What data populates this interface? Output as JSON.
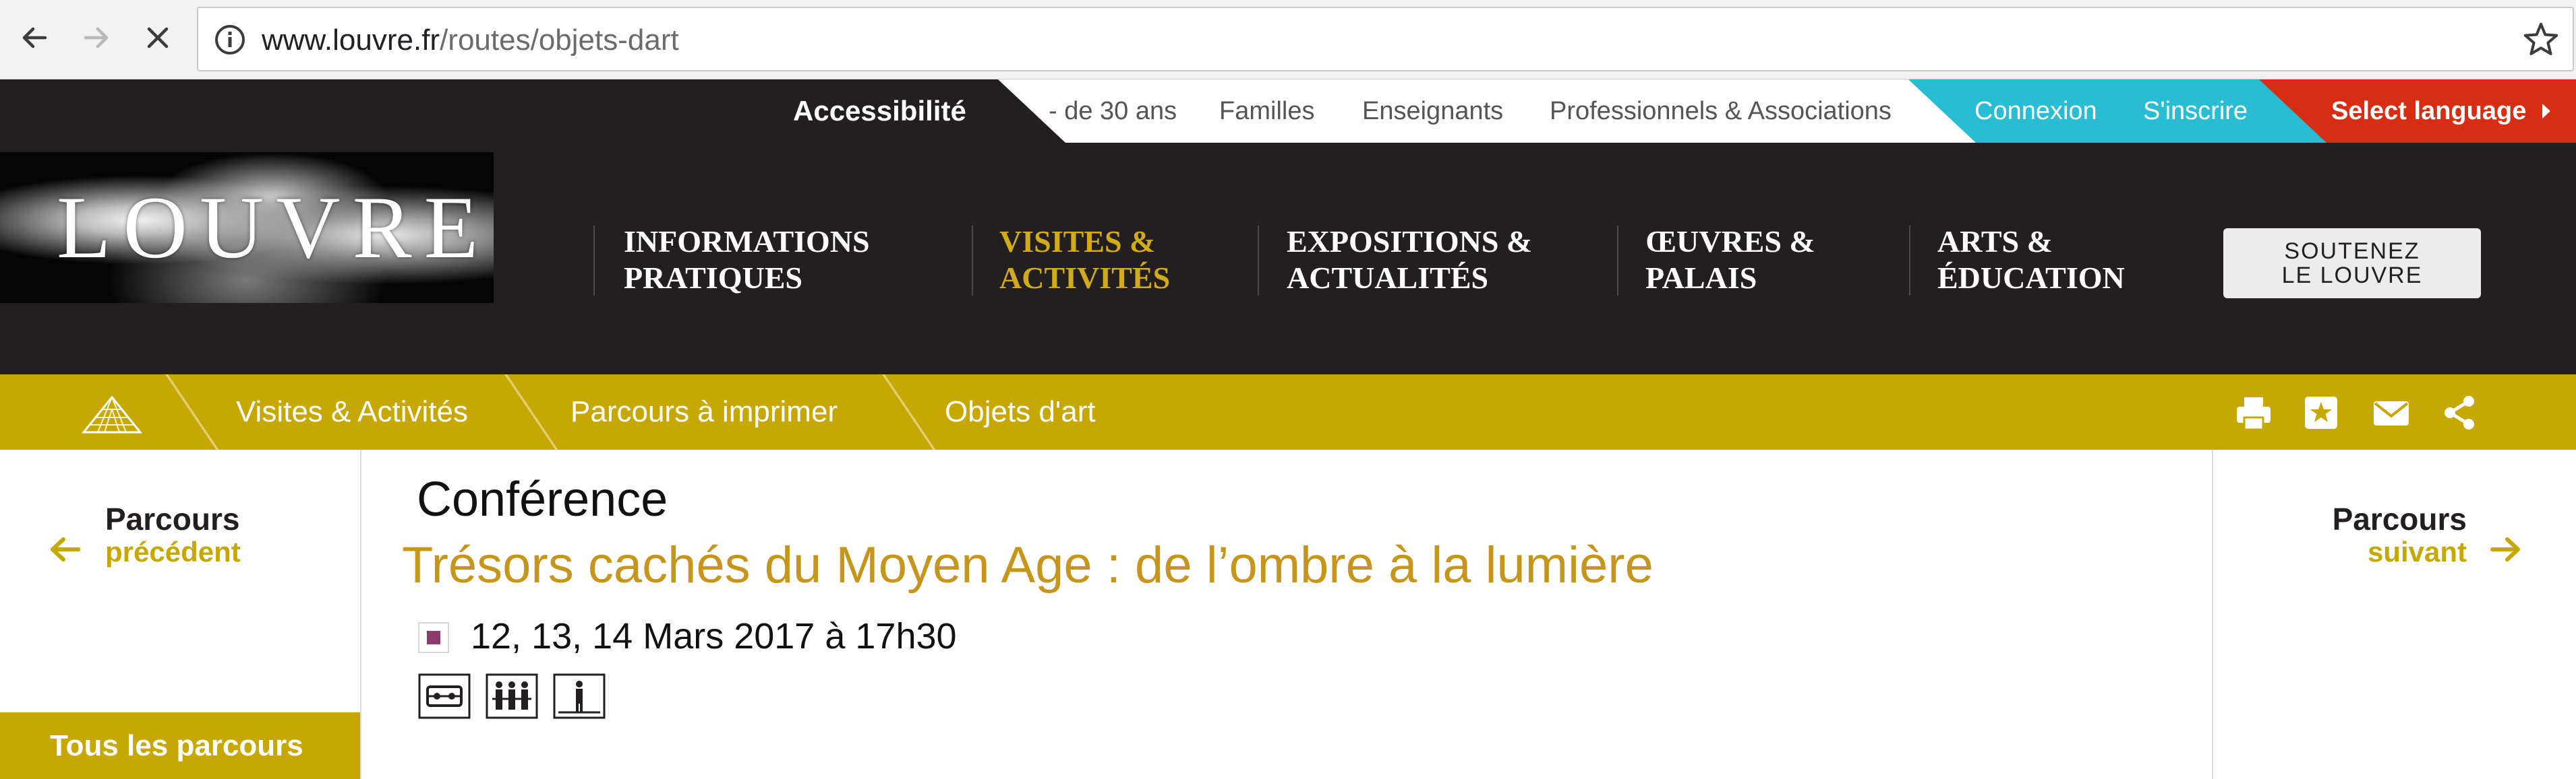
{
  "browser": {
    "url_domain": "www.louvre.fr",
    "url_path": "/routes/objets-dart"
  },
  "utility_bar": {
    "accessibility": "Accessibilité",
    "links": [
      "- de 30 ans",
      "Familles",
      "Enseignants",
      "Professionnels & Associations"
    ],
    "login": "Connexion",
    "register": "S'inscrire",
    "language": "Select language"
  },
  "header": {
    "logo": "LOUVRE",
    "nav": [
      {
        "label": "INFORMATIONS\nPRATIQUES"
      },
      {
        "label": "VISITES &\nACTIVITÉS"
      },
      {
        "label": "EXPOSITIONS &\nACTUALITÉS"
      },
      {
        "label": "ŒUVRES &\nPALAIS"
      },
      {
        "label": "ARTS &\nÉDUCATION"
      }
    ],
    "donate": "SOUTENEZ\nLE LOUVRE"
  },
  "breadcrumb": [
    "Visites & Activités",
    "Parcours à imprimer",
    "Objets d'art"
  ],
  "content": {
    "previous": {
      "label": "Parcours",
      "sub": "précédent"
    },
    "next": {
      "label": "Parcours",
      "sub": "suivant"
    },
    "all_routes": "Tous les parcours",
    "kicker": "Conférence",
    "title": "Trésors cachés du Moyen Age : de l’ombre à la lumière",
    "date": "12, 13, 14 Mars 2017 à 17h30"
  },
  "colors": {
    "dark": "#231f20",
    "gold": "#c7a803",
    "title_gold": "#c7951a",
    "cyan": "#28bdd2",
    "red": "#d62d13",
    "date_marker": "#8c3b6c"
  },
  "icons": [
    "back-icon",
    "forward-icon",
    "stop-icon",
    "info-icon",
    "star-icon",
    "pyramid-icon",
    "print-icon",
    "bookmark-icon",
    "mail-icon",
    "share-icon",
    "arrow-left-icon",
    "arrow-right-icon",
    "hearing-loop-icon",
    "group-icon",
    "guide-icon"
  ]
}
